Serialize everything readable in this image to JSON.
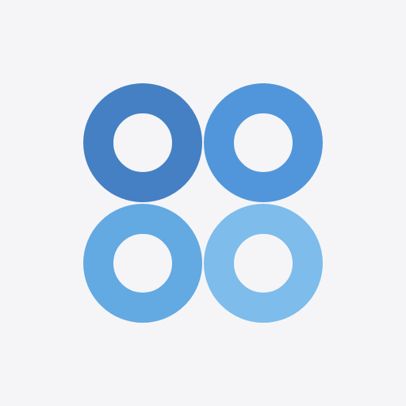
{
  "logo": {
    "name": "four-rings-logo",
    "rings": [
      {
        "name": "ring-top-left",
        "color": "#4480C3"
      },
      {
        "name": "ring-top-right",
        "color": "#5196DA"
      },
      {
        "name": "ring-bottom-left",
        "color": "#63A9E2"
      },
      {
        "name": "ring-bottom-right",
        "color": "#7DBCEB"
      }
    ]
  },
  "background": "#F5F5F7"
}
